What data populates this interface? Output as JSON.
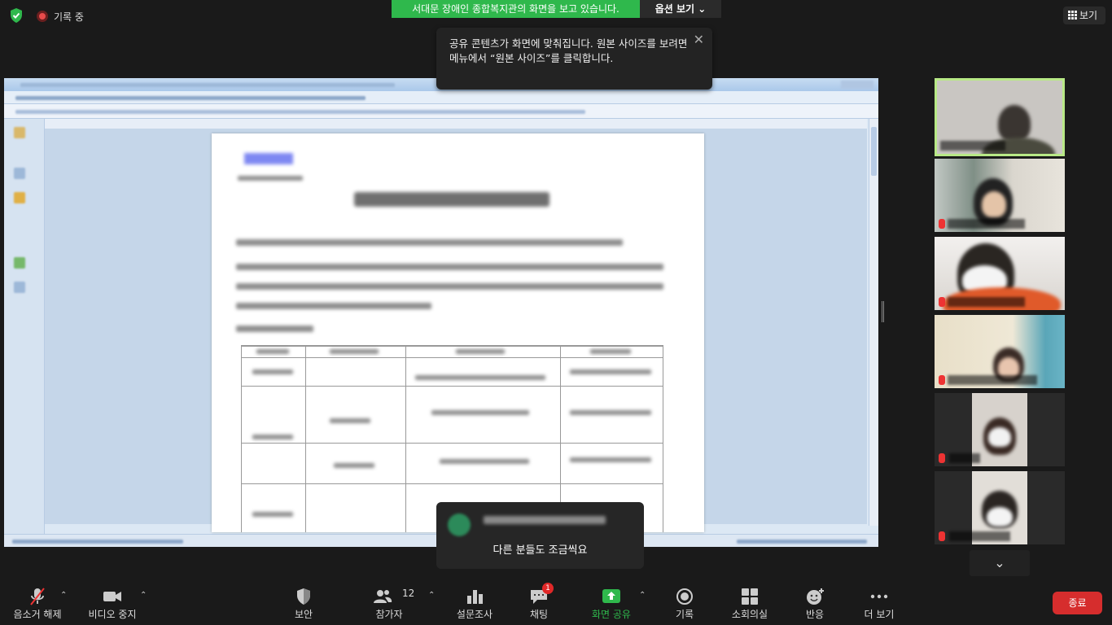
{
  "top": {
    "recording_label": "기록 중",
    "share_banner": "서대문 장애인 종합복지관의 화면을 보고 있습니다.",
    "view_options": "옵션 보기",
    "view_button": "보기"
  },
  "tooltip": {
    "text": "공유 콘텐츠가 화면에 맞춰집니다. 원본 사이즈를 보려면 메뉴에서 “원본 사이즈”를 클릭합니다."
  },
  "chat_toast": {
    "message": "다른 분들도 조금씩요"
  },
  "toolbar": {
    "unmute": "음소거 해제",
    "stop_video": "비디오 중지",
    "security": "보안",
    "participants": "참가자",
    "participants_count": "12",
    "polls": "설문조사",
    "chat": "채팅",
    "chat_badge": "1",
    "share_screen": "화면 공유",
    "record": "기록",
    "breakout": "소회의실",
    "reactions": "반응",
    "more": "더 보기",
    "end": "종료"
  },
  "colors": {
    "share_banner": "#2fb84c",
    "end_button": "#d62d2d",
    "share_screen": "#2fb84c",
    "active_speaker_border": "#b8e986"
  }
}
